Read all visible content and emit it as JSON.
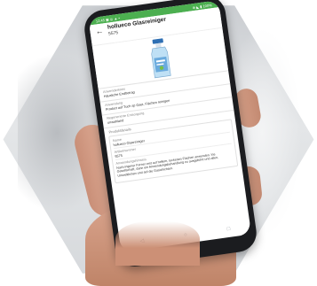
{
  "status_bar": {
    "left": "12:45 ▣ ◎ ▲ •",
    "right": "⊕ ◣ ▮ 100%"
  },
  "app_bar": {
    "back_icon": "arrow-left-icon",
    "title": "hollueco Glasreiniger",
    "subtitle": "5575"
  },
  "product": {
    "image": "spray-bottle-icon",
    "bottle_color": "#5aa0d8"
  },
  "fields": [
    {
      "label": "Anwenderkreis",
      "value": "Häusliche Endbetrag"
    },
    {
      "label": "Anwendung",
      "value": "Product auf Tuch sp Gaei, Flächen reinigen"
    },
    {
      "label": "Regenerierte Entsorgung",
      "value": "unwahland"
    }
  ],
  "details": {
    "heading": "Produktdetails",
    "rows": [
      {
        "label": "Name",
        "value": "hollueco Glasreiniger"
      },
      {
        "label": "Artikelnummer",
        "value": "5575"
      },
      {
        "label": "Anwendungshinweis",
        "value": "Nach ingener Ferner erst auf hellem, tockenen Flächen anwenden. Ins Gesellschaft, dann ein Anwendungsbehandlung zu ausgeführt und allen, Umweltlichen und auf die Gasichichten."
      }
    ]
  },
  "nav": {
    "back": "◁",
    "home": "○",
    "recents": "□"
  },
  "colors": {
    "accent": "#4caf50"
  }
}
